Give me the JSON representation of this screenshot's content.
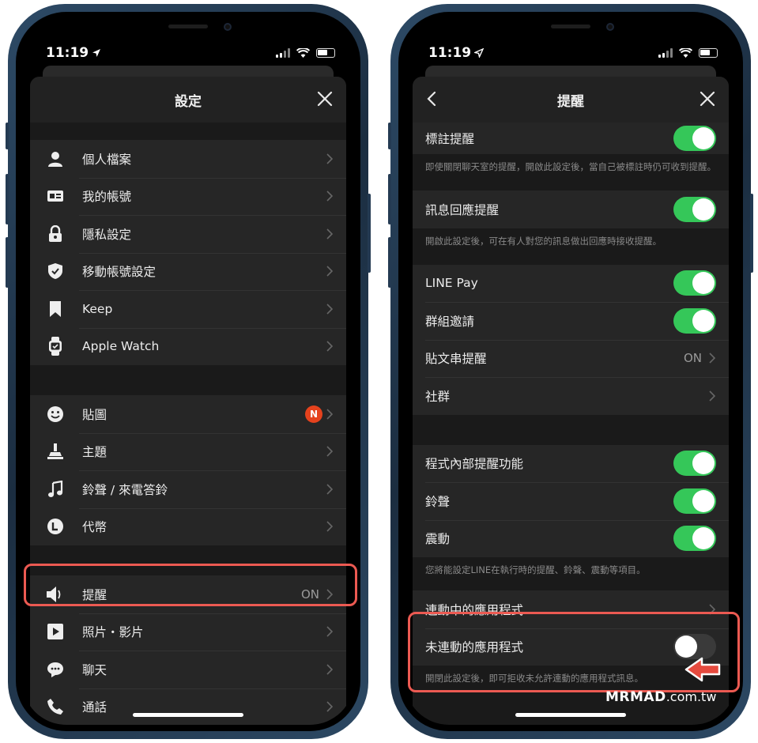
{
  "left_phone": {
    "status": {
      "time": "11:19"
    },
    "header": {
      "title": "設定"
    },
    "group1": [
      {
        "label": "個人檔案",
        "icon": "person-icon"
      },
      {
        "label": "我的帳號",
        "icon": "id-card-icon"
      },
      {
        "label": "隱私設定",
        "icon": "lock-icon"
      },
      {
        "label": "移動帳號設定",
        "icon": "shield-icon"
      },
      {
        "label": "Keep",
        "icon": "bookmark-icon"
      },
      {
        "label": "Apple Watch",
        "icon": "watch-icon"
      }
    ],
    "group2": [
      {
        "label": "貼圖",
        "icon": "smiley-icon",
        "badge": "N"
      },
      {
        "label": "主題",
        "icon": "brush-icon"
      },
      {
        "label": "鈴聲 / 來電答鈴",
        "icon": "music-note-icon"
      },
      {
        "label": "代幣",
        "icon": "coin-icon"
      }
    ],
    "group3": [
      {
        "label": "提醒",
        "icon": "speaker-icon",
        "value": "ON"
      },
      {
        "label": "照片・影片",
        "icon": "play-icon"
      },
      {
        "label": "聊天",
        "icon": "chat-icon"
      },
      {
        "label": "通話",
        "icon": "phone-icon"
      }
    ]
  },
  "right_phone": {
    "status": {
      "time": "11:19"
    },
    "header": {
      "title": "提醒"
    },
    "mention": {
      "label": "標註提醒",
      "toggle": true,
      "note": "即使關閉聊天室的提醒，開啟此設定後，當自己被標註時仍可收到提醒。"
    },
    "reply": {
      "label": "訊息回應提醒",
      "toggle": true,
      "note": "開啟此設定後，可在有人對您的訊息做出回應時接收提醒。"
    },
    "group_a": [
      {
        "label": "LINE Pay",
        "toggle": true
      },
      {
        "label": "群組邀請",
        "toggle": true
      },
      {
        "label": "貼文串提醒",
        "value": "ON"
      },
      {
        "label": "社群"
      }
    ],
    "group_b": [
      {
        "label": "程式內部提醒功能",
        "toggle": true
      },
      {
        "label": "鈴聲",
        "toggle": true
      },
      {
        "label": "震動",
        "toggle": true
      }
    ],
    "group_b_note": "您將能設定LINE在執行時的提醒、鈴聲、震動等項目。",
    "group_c": [
      {
        "label": "連動中的應用程式"
      },
      {
        "label": "未連動的應用程式",
        "toggle": false
      }
    ],
    "group_c_note": "開閉此設定後，即可拒收未允許連動的應用程式訊息。"
  },
  "watermark": {
    "brand": "MRMAD",
    "suffix": ".com.tw"
  },
  "colors": {
    "toggle_on": "#35c759",
    "highlight": "#ec5a52",
    "badge": "#e5421d",
    "background": "#1a1a1a"
  }
}
